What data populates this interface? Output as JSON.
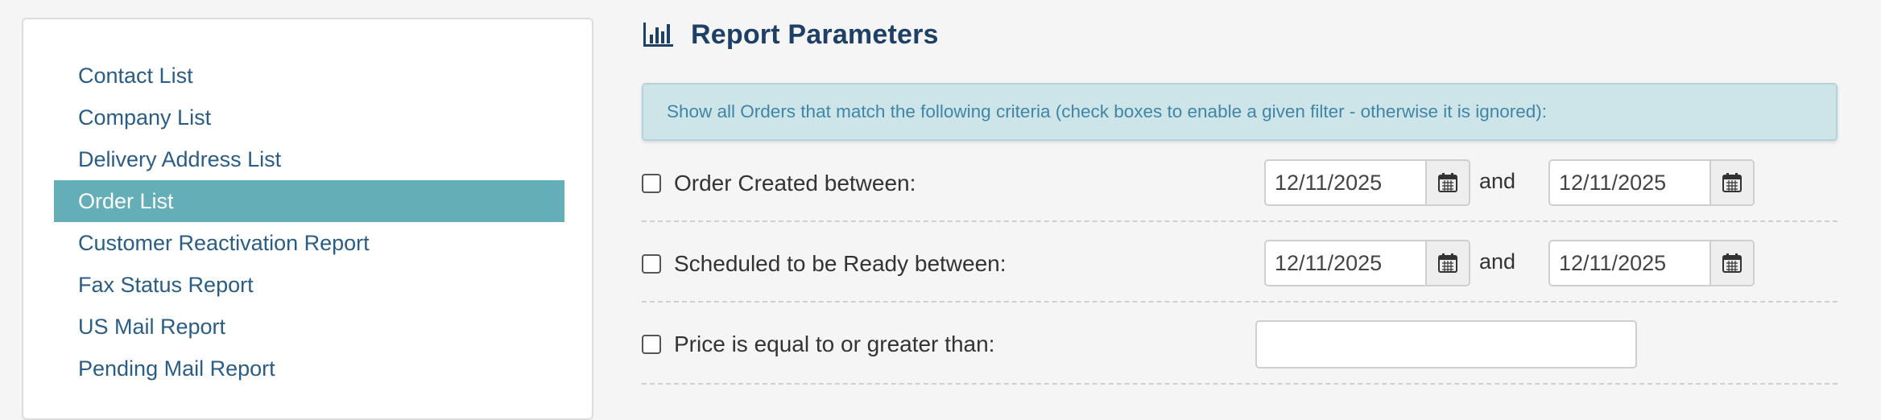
{
  "sidebar": {
    "items": [
      {
        "label": "Contact List",
        "active": false
      },
      {
        "label": "Company List",
        "active": false
      },
      {
        "label": "Delivery Address List",
        "active": false
      },
      {
        "label": "Order List",
        "active": true
      },
      {
        "label": "Customer Reactivation Report",
        "active": false
      },
      {
        "label": "Fax Status Report",
        "active": false
      },
      {
        "label": "US Mail Report",
        "active": false
      },
      {
        "label": "Pending Mail Report",
        "active": false
      }
    ]
  },
  "main": {
    "title": "Report Parameters",
    "title_icon": "bar-chart-icon",
    "info_text": "Show all Orders that match the following criteria (check boxes to enable a given filter - otherwise it is ignored):",
    "filters": [
      {
        "label": "Order Created between:",
        "checked": false,
        "from_date": "12/11/2025",
        "and_label": "and",
        "to_date": "12/11/2025"
      },
      {
        "label": "Scheduled to be Ready between:",
        "checked": false,
        "from_date": "12/11/2025",
        "and_label": "and",
        "to_date": "12/11/2025"
      },
      {
        "label": "Price is equal to or greater than:",
        "checked": false,
        "value": ""
      }
    ]
  },
  "colors": {
    "accent": "#64aeb8",
    "link": "#2a5d86",
    "title": "#1e3f66",
    "info_bg": "#cde4e9",
    "info_text": "#3f86a6"
  }
}
